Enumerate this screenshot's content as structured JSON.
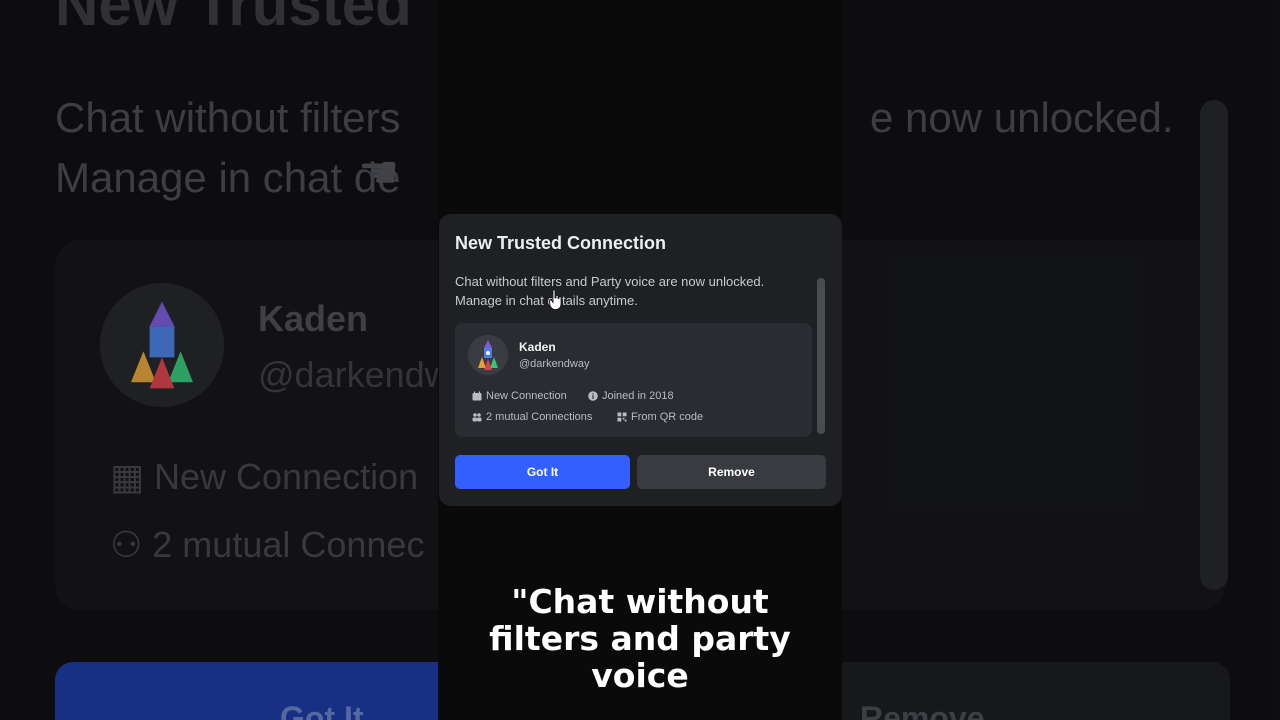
{
  "dialog": {
    "title": "New Trusted Connection",
    "body_line1": "Chat without filters and Party voice are now unlocked.",
    "body_line2": "Manage in chat details anytime.",
    "user": {
      "name": "Kaden",
      "handle": "@darkendway",
      "meta": {
        "new_connection": "New Connection",
        "joined": "Joined in 2018",
        "mutual": "2 mutual Connections",
        "source": "From QR code"
      }
    },
    "buttons": {
      "primary_label": "Got It",
      "secondary_label": "Remove"
    }
  },
  "background": {
    "title_fragment": "New Trusted",
    "desc_line1": "Chat without filters",
    "desc_line1_end": "e now unlocked.",
    "desc_line2": "Manage in chat de",
    "name": "Kaden",
    "handle": "@darkendw",
    "new_connection": "New Connection",
    "mutual": "2 mutual Connec",
    "got_it": "Got It",
    "remove": "Remove"
  },
  "caption": {
    "line1": "\"Chat without",
    "line2": "filters and party",
    "line3": "voice"
  },
  "colors": {
    "primary_button": "#335fff",
    "secondary_button": "#393b40",
    "dialog_bg": "#1f2024",
    "card_bg": "#2a2c31"
  },
  "icons": {
    "calendar": "calendar-icon",
    "info": "info-icon",
    "people": "people-icon",
    "qr": "qr-code-icon",
    "pointer": "hand-pointer-icon"
  }
}
